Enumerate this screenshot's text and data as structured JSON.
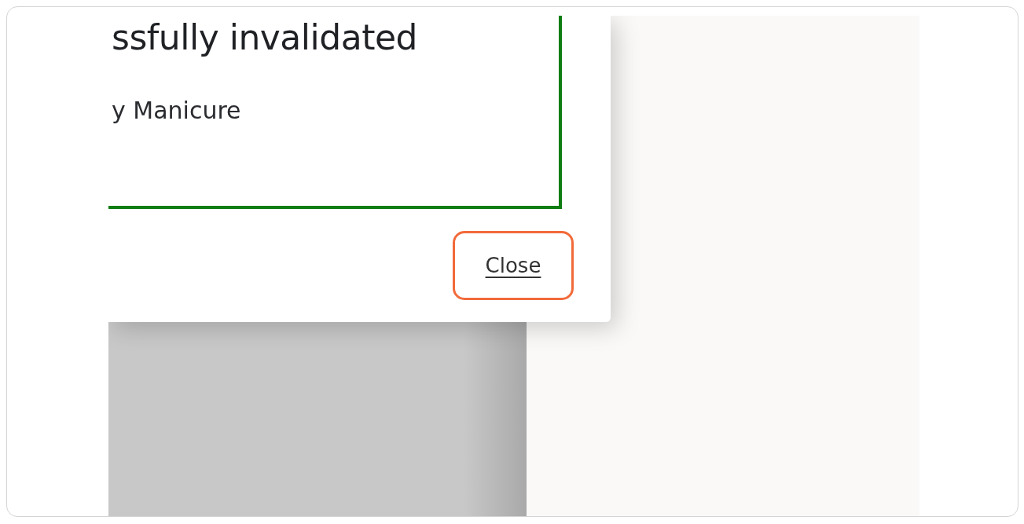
{
  "dialog": {
    "heading": "ssfully invalidated",
    "detail": "y Manicure",
    "close_button": "Close"
  }
}
